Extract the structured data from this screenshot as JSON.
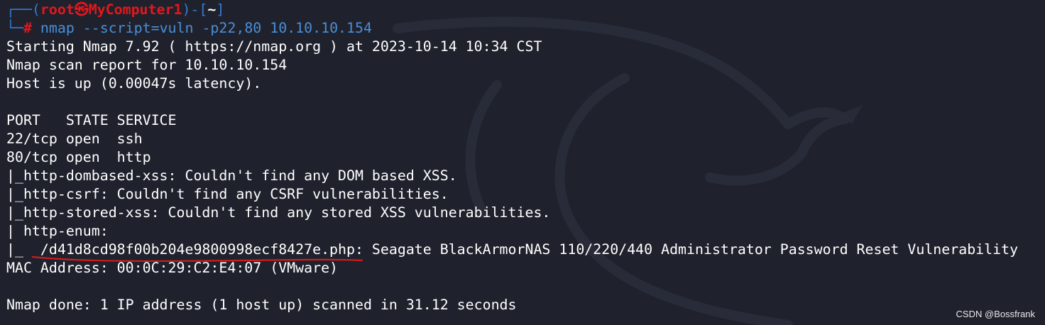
{
  "prompt": {
    "corner_top": "┌──(",
    "user": "root",
    "at_icon": "㉿",
    "host": "MyComputer1",
    "mid": ")-[",
    "dir": "~",
    "close": "]",
    "corner_bottom": "└─",
    "hash": "#",
    "command": "nmap",
    "args": " --script=vuln -p22,80 10.10.10.154"
  },
  "output": {
    "line1": "Starting Nmap 7.92 ( https://nmap.org ) at 2023-10-14 10:34 CST",
    "line2": "Nmap scan report for 10.10.10.154",
    "line3": "Host is up (0.00047s latency).",
    "line4": "",
    "line5": "PORT   STATE SERVICE",
    "line6": "22/tcp open  ssh",
    "line7": "80/tcp open  http",
    "line8": "|_http-dombased-xss: Couldn't find any DOM based XSS.",
    "line9": "|_http-csrf: Couldn't find any CSRF vulnerabilities.",
    "line10": "|_http-stored-xss: Couldn't find any stored XSS vulnerabilities.",
    "line11": "| http-enum: ",
    "line12": "|_  /d41d8cd98f00b204e9800998ecf8427e.php: Seagate BlackArmorNAS 110/220/440 Administrator Password Reset Vulnerability",
    "line13": "MAC Address: 00:0C:29:C2:E4:07 (VMware)",
    "line14": "",
    "line15": "Nmap done: 1 IP address (1 host up) scanned in 31.12 seconds"
  },
  "credit": "CSDN @Bossfrank",
  "colors": {
    "background": "#1f222d",
    "prompt_frame": "#3579d4",
    "prompt_user": "#e3171c",
    "command": "#4a8ed8",
    "annotation_underline": "#d31c1c"
  }
}
